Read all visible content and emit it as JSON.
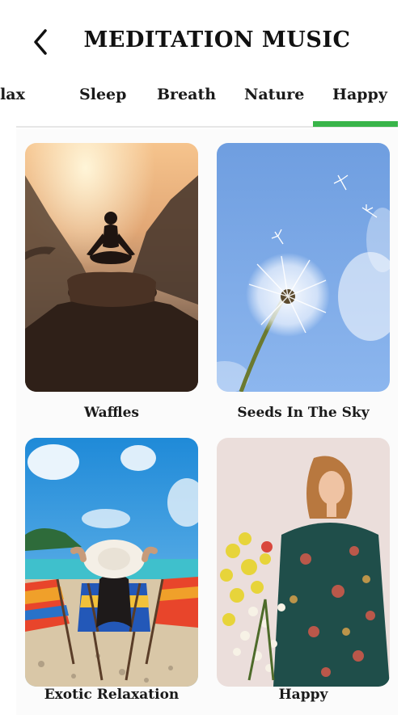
{
  "header": {
    "title": "MEDITATION MUSIC",
    "back_icon": "chevron-left-icon"
  },
  "tabs": [
    {
      "label": "Relax",
      "shown": "elax",
      "active": false
    },
    {
      "label": "Sleep",
      "active": false
    },
    {
      "label": "Breath",
      "active": false
    },
    {
      "label": "Nature",
      "active": false
    },
    {
      "label": "Happy",
      "active": true
    }
  ],
  "accent_color": "#39b54a",
  "tracks": [
    {
      "title": "Waffles",
      "image": "person meditating on a rock at sunrise"
    },
    {
      "title": "Seeds In The Sky",
      "image": "dandelion against a blue sky"
    },
    {
      "title": "Exotic Relaxation",
      "image": "woman in sun hat on beach deck chairs"
    },
    {
      "title": "Happy",
      "image": "woman in floral dress holding flowers"
    }
  ]
}
